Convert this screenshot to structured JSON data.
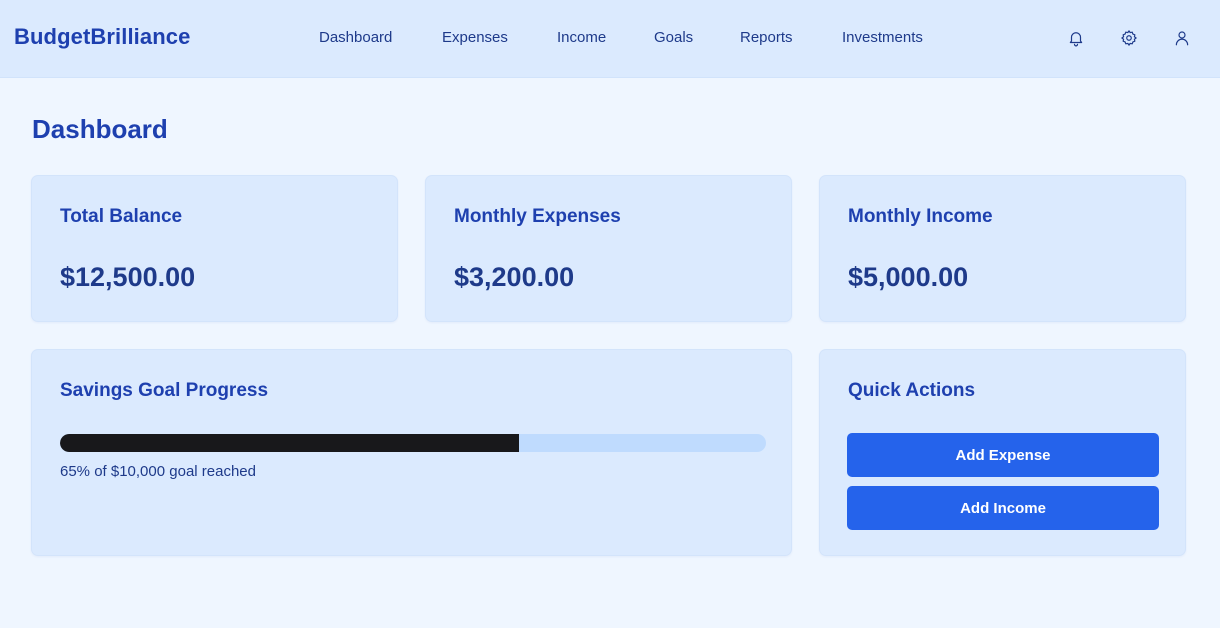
{
  "app": {
    "brand": "BudgetBrilliance"
  },
  "nav": {
    "items": [
      {
        "label": "Dashboard"
      },
      {
        "label": "Expenses"
      },
      {
        "label": "Income"
      },
      {
        "label": "Goals"
      },
      {
        "label": "Reports"
      },
      {
        "label": "Investments"
      }
    ]
  },
  "header_icons": [
    "bell-icon",
    "gear-icon",
    "user-icon"
  ],
  "page": {
    "title": "Dashboard"
  },
  "stats": [
    {
      "title": "Total Balance",
      "value": "$12,500.00"
    },
    {
      "title": "Monthly Expenses",
      "value": "$3,200.00"
    },
    {
      "title": "Monthly Income",
      "value": "$5,000.00"
    }
  ],
  "savings": {
    "title": "Savings Goal Progress",
    "progress_percent": 65,
    "caption": "65% of $10,000 goal reached"
  },
  "quick_actions": {
    "title": "Quick Actions",
    "buttons": [
      {
        "label": "Add Expense"
      },
      {
        "label": "Add Income"
      }
    ]
  },
  "colors": {
    "header_bg": "#dbeafe",
    "page_bg": "#eff6ff",
    "card_bg": "#dbeafe",
    "brand_text": "#1e40af",
    "primary_button": "#2563eb",
    "progress_fill": "#18181b",
    "progress_track": "#bfdbfe"
  }
}
